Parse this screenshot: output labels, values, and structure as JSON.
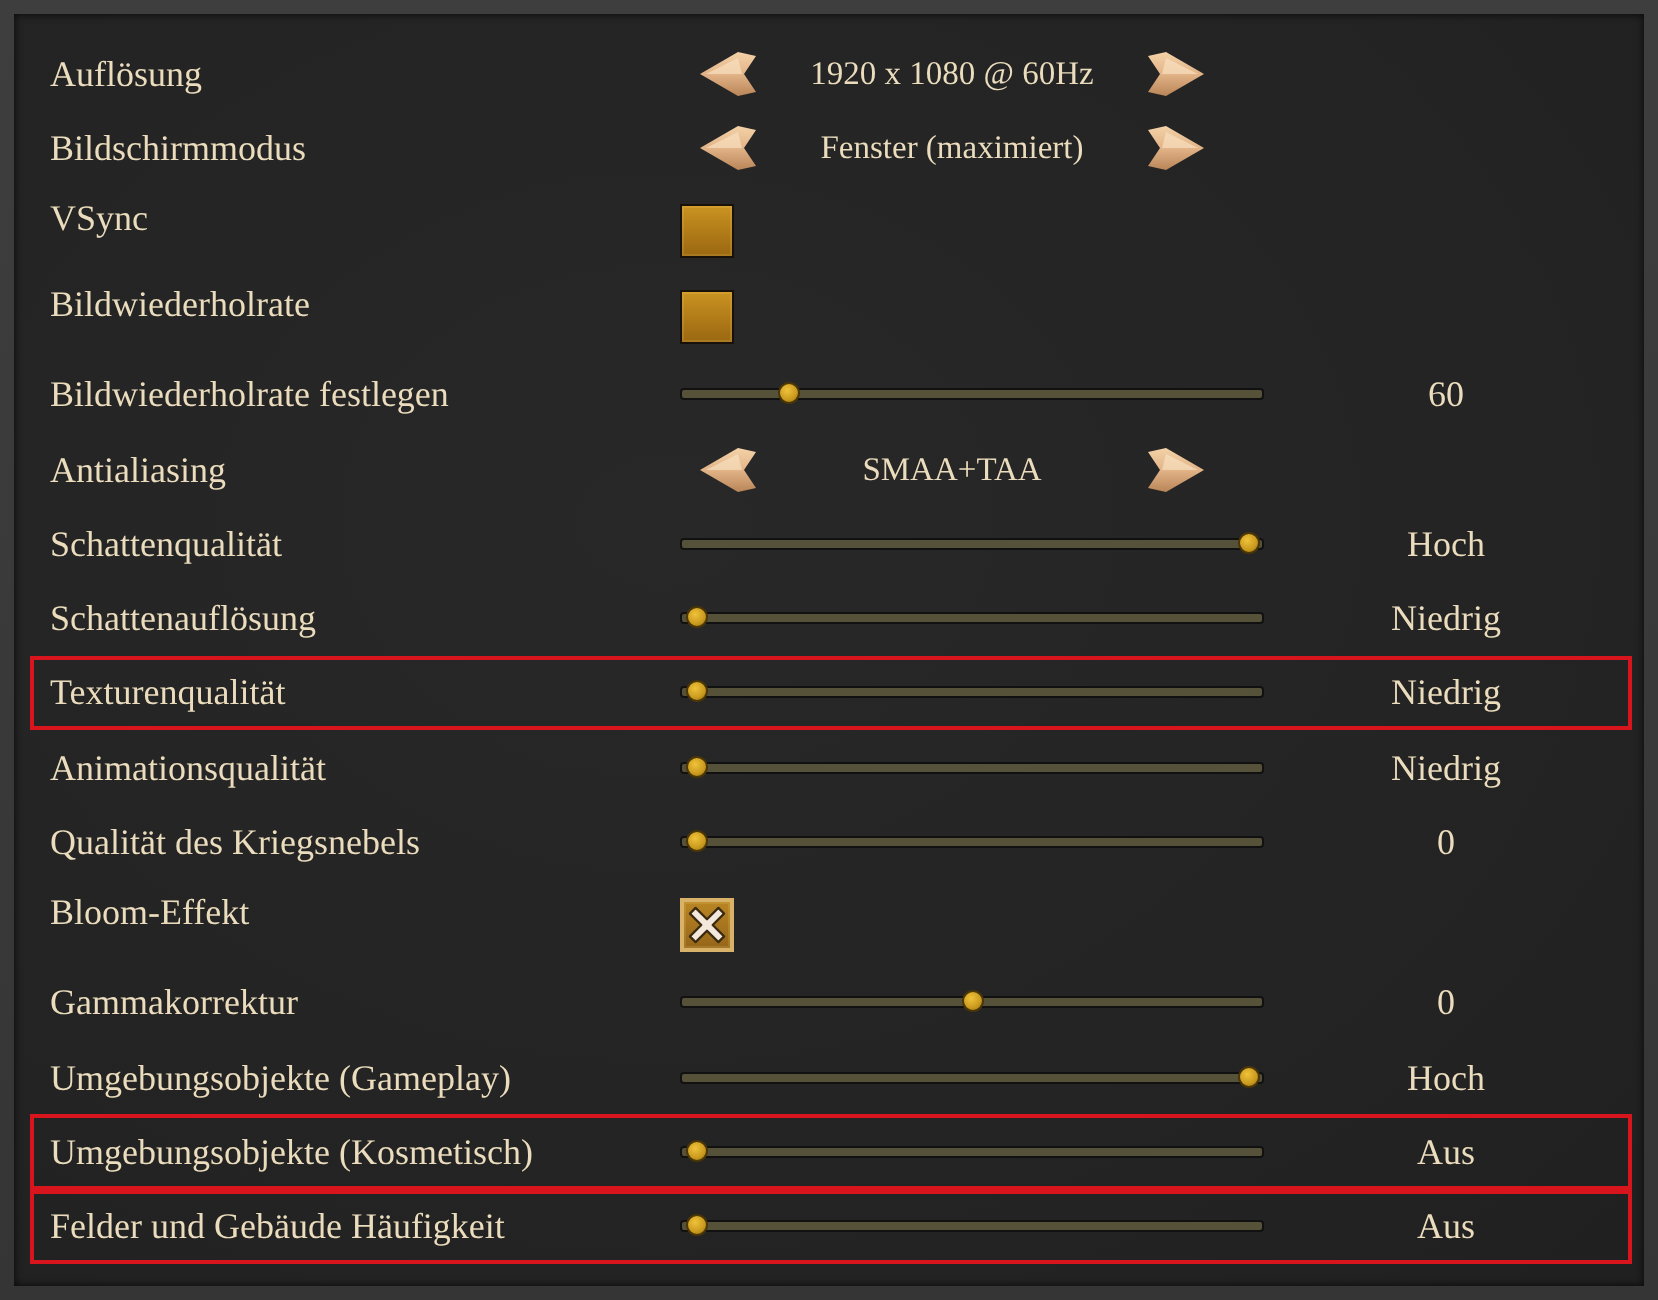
{
  "settings": [
    {
      "kind": "selector",
      "label": "Auflösung",
      "value": "1920 x 1080 @ 60Hz",
      "highlighted": false
    },
    {
      "kind": "selector",
      "label": "Bildschirmmodus",
      "value": "Fenster (maximiert)",
      "highlighted": false
    },
    {
      "kind": "checkbox",
      "label": "VSync",
      "checked": false,
      "highlighted": false
    },
    {
      "kind": "checkbox",
      "label": "Bildwiederholrate",
      "checked": false,
      "highlighted": false
    },
    {
      "kind": "slider",
      "label": "Bildwiederholrate festlegen",
      "level": 0.17,
      "reading": "60",
      "highlighted": false
    },
    {
      "kind": "selector",
      "label": "Antialiasing",
      "value": "SMAA+TAA",
      "highlighted": false
    },
    {
      "kind": "slider",
      "label": "Schattenqualität",
      "level": 1,
      "reading": "Hoch",
      "highlighted": false
    },
    {
      "kind": "slider",
      "label": "Schattenauflösung",
      "level": 0,
      "reading": "Niedrig",
      "highlighted": false
    },
    {
      "kind": "slider",
      "label": "Texturenqualität",
      "level": 0,
      "reading": "Niedrig",
      "highlighted": true
    },
    {
      "kind": "slider",
      "label": "Animationsqualität",
      "level": 0,
      "reading": "Niedrig",
      "highlighted": false
    },
    {
      "kind": "slider",
      "label": "Qualität des Kriegsnebels",
      "level": 0,
      "reading": "0",
      "highlighted": false
    },
    {
      "kind": "checkbox",
      "label": "Bloom-Effekt",
      "checked": true,
      "highlighted": false
    },
    {
      "kind": "slider",
      "label": "Gammakorrektur",
      "level": 0.5,
      "reading": "0",
      "highlighted": false
    },
    {
      "kind": "slider",
      "label": "Umgebungsobjekte (Gameplay)",
      "level": 1,
      "reading": "Hoch",
      "highlighted": false
    },
    {
      "kind": "slider",
      "label": "Umgebungsobjekte (Kosmetisch)",
      "level": 0,
      "reading": "Aus",
      "highlighted": true
    },
    {
      "kind": "slider",
      "label": "Felder und Gebäude Häufigkeit",
      "level": 0,
      "reading": "Aus",
      "highlighted": true
    }
  ]
}
